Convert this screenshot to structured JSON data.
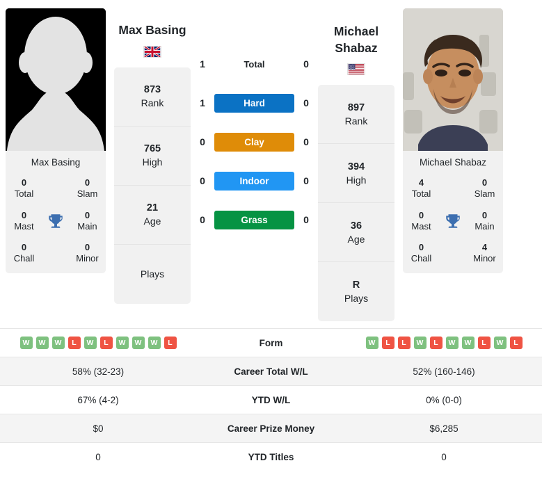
{
  "players": {
    "left": {
      "name": "Max Basing",
      "caption_name": "Max Basing",
      "country_flag": "uk-flag-icon",
      "photo": "placeholder-silhouette-avatar",
      "rank": "873",
      "rank_label": "Rank",
      "high": "765",
      "high_label": "High",
      "age": "21",
      "age_label": "Age",
      "plays": "",
      "plays_label": "Plays",
      "titles": {
        "total": "0",
        "total_label": "Total",
        "slam": "0",
        "slam_label": "Slam",
        "mast": "0",
        "mast_label": "Mast",
        "main": "0",
        "main_label": "Main",
        "chall": "0",
        "chall_label": "Chall",
        "minor": "0",
        "minor_label": "Minor"
      },
      "form": [
        "W",
        "W",
        "W",
        "L",
        "W",
        "L",
        "W",
        "W",
        "W",
        "L"
      ],
      "career_total_wl": "58% (32-23)",
      "ytd_wl": "67% (4-2)",
      "career_prize_money": "$0",
      "ytd_titles": "0"
    },
    "right": {
      "name_line1": "Michael",
      "name_line2": "Shabaz",
      "caption_name": "Michael Shabaz",
      "country_flag": "us-flag-icon",
      "photo": "player-headshot-photo",
      "rank": "897",
      "rank_label": "Rank",
      "high": "394",
      "high_label": "High",
      "age": "36",
      "age_label": "Age",
      "plays": "R",
      "plays_label": "Plays",
      "titles": {
        "total": "4",
        "total_label": "Total",
        "slam": "0",
        "slam_label": "Slam",
        "mast": "0",
        "mast_label": "Mast",
        "main": "0",
        "main_label": "Main",
        "chall": "0",
        "chall_label": "Chall",
        "minor": "4",
        "minor_label": "Minor"
      },
      "form": [
        "W",
        "L",
        "L",
        "W",
        "L",
        "W",
        "W",
        "L",
        "W",
        "L"
      ],
      "career_total_wl": "52% (160-146)",
      "ytd_wl": "0% (0-0)",
      "career_prize_money": "$6,285",
      "ytd_titles": "0"
    }
  },
  "head_to_head": [
    {
      "key": "total",
      "label": "Total",
      "left": "1",
      "right": "0",
      "style": "plain",
      "color": ""
    },
    {
      "key": "hard",
      "label": "Hard",
      "left": "1",
      "right": "0",
      "style": "pill",
      "color": "#0b72c4"
    },
    {
      "key": "clay",
      "label": "Clay",
      "left": "0",
      "right": "0",
      "style": "pill",
      "color": "#df8c08"
    },
    {
      "key": "indoor",
      "label": "Indoor",
      "left": "0",
      "right": "0",
      "style": "pill",
      "color": "#2196f3"
    },
    {
      "key": "grass",
      "label": "Grass",
      "left": "0",
      "right": "0",
      "style": "pill",
      "color": "#069343"
    }
  ],
  "stats_rows": [
    {
      "key": "form",
      "label": "Form",
      "type": "form"
    },
    {
      "key": "career_total_wl",
      "label": "Career Total W/L",
      "type": "text"
    },
    {
      "key": "ytd_wl",
      "label": "YTD W/L",
      "type": "text"
    },
    {
      "key": "career_prize_money",
      "label": "Career Prize Money",
      "type": "text"
    },
    {
      "key": "ytd_titles",
      "label": "YTD Titles",
      "type": "text"
    }
  ],
  "colors": {
    "win_badge": "#7ec17f",
    "loss_badge": "#ef5343",
    "trophy": "#3d6fb0",
    "card_bg": "#f1f1f1",
    "row_alt_bg": "#f4f4f4"
  }
}
